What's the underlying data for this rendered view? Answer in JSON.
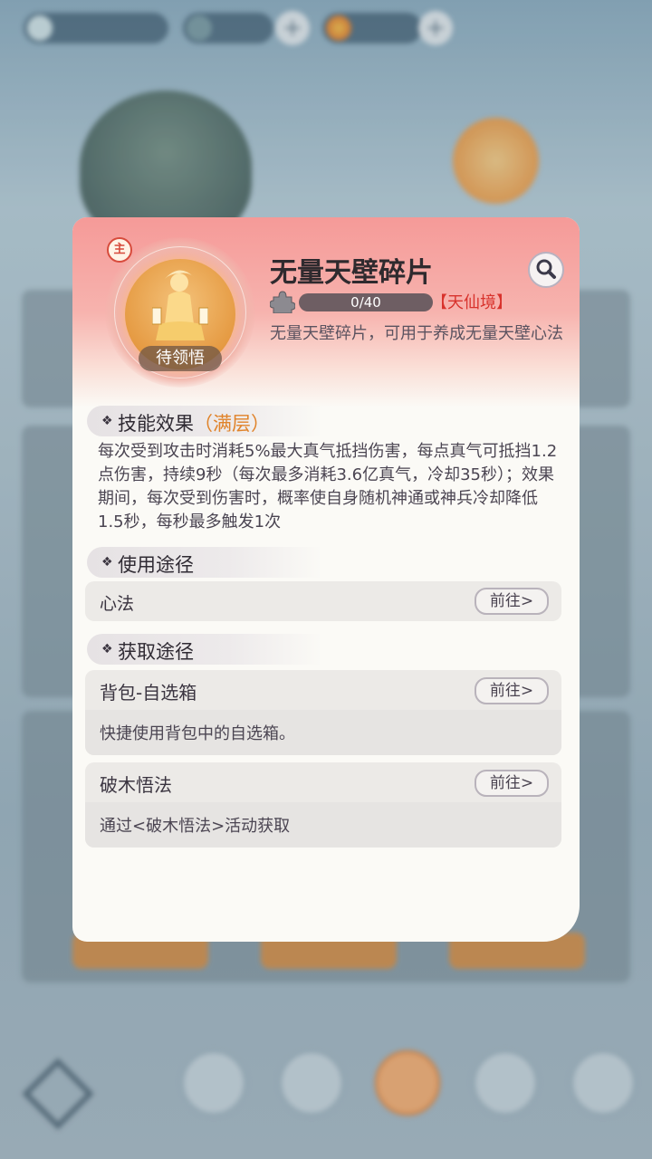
{
  "popup": {
    "item_name": "无量天壁碎片",
    "main_badge": "主",
    "status": "待领悟",
    "progress_text": "0/40",
    "progress_fraction": 0,
    "realm": "【天仙境】",
    "description": "无量天壁碎片，可用于养成无量天壁心法",
    "icons": {
      "search": "search-icon",
      "fragment": "puzzle-piece-icon",
      "avatar": "golden-figure-icon"
    }
  },
  "skill": {
    "title": "技能效果",
    "tag": "（满层）",
    "text": "每次受到攻击时消耗5%最大真气抵挡伤害，每点真气可抵挡1.2点伤害，持续9秒（每次最多消耗3.6亿真气，冷却35秒）；效果期间，每次受到伤害时，概率使自身随机神通或神兵冷却降低1.5秒，每秒最多触发1次"
  },
  "usage": {
    "title": "使用途径",
    "items": [
      {
        "label": "心法",
        "go": "前往>"
      }
    ]
  },
  "source": {
    "title": "获取途径",
    "items": [
      {
        "label": "背包-自选箱",
        "go": "前往>",
        "desc": "快捷使用背包中的自选箱。"
      },
      {
        "label": "破木悟法",
        "go": "前往>",
        "desc": "通过<破木悟法>活动获取"
      }
    ]
  },
  "colors": {
    "header_pink": "#f59a98",
    "realm_red": "#d8322c",
    "tag_orange": "#e0832a",
    "panel_bg": "#fbfaf6"
  }
}
